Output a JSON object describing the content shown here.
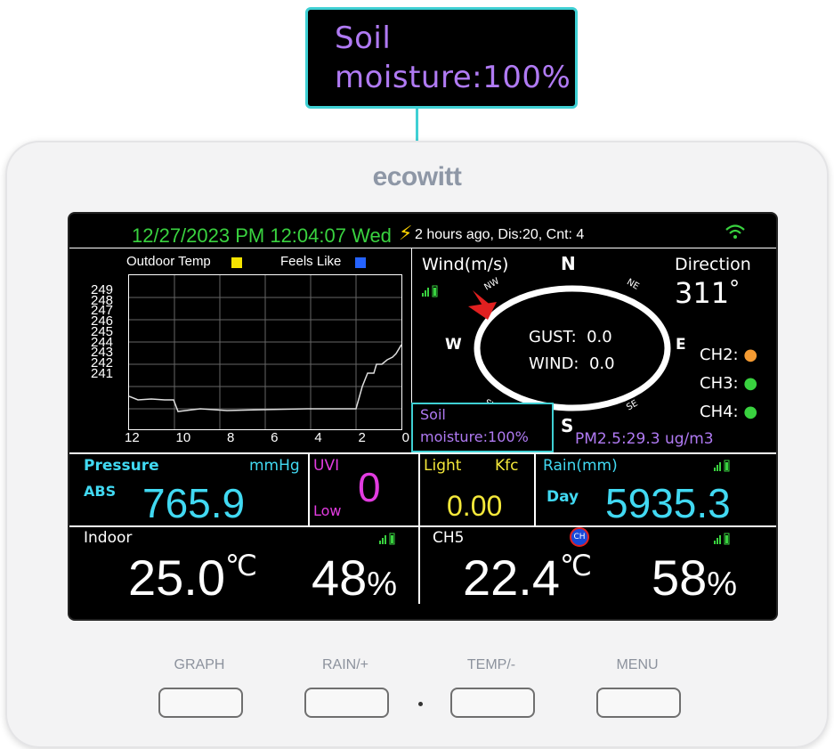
{
  "callout": {
    "line1": "Soil",
    "line2": "moisture:100%"
  },
  "brand": "ecowitt",
  "status_bar": {
    "datetime": "12/27/2023 PM 12:04:07 Wed",
    "lightning": "2 hours ago, Dis:20, Cnt: 4"
  },
  "graph": {
    "legend_outdoor": "Outdoor Temp",
    "legend_feels": "Feels Like",
    "outdoor_color": "#f5e400",
    "feels_color": "#2563ff",
    "y_ticks": [
      "249",
      "248",
      "247",
      "246",
      "245",
      "244",
      "243",
      "242",
      "241"
    ],
    "x_ticks": [
      "12",
      "10",
      "8",
      "6",
      "4",
      "2",
      "0"
    ]
  },
  "wind": {
    "title": "Wind(m/s)",
    "direction_label": "Direction",
    "direction_value": "311",
    "degree": "°",
    "compass_n": "N",
    "compass_s": "S",
    "compass_e": "E",
    "compass_w": "W",
    "compass_nw": "NW",
    "compass_ne": "NE",
    "compass_sw": "SW",
    "compass_se": "SE",
    "gust": "GUST:  0.0",
    "wind": "WIND:  0.0",
    "ch2": "CH2:",
    "ch3": "CH3:",
    "ch4": "CH4:",
    "soil_line1": "Soil",
    "soil_line2": "moisture:100%",
    "pm25": "PM2.5:29.3 ug/m3"
  },
  "pressure": {
    "title": "Pressure",
    "unit": "mmHg",
    "abs": "ABS",
    "value": "765.9"
  },
  "uvi": {
    "title": "UVI",
    "value": "0",
    "level": "Low"
  },
  "light": {
    "title": "Light",
    "unit": "Kfc",
    "value": "0.00"
  },
  "rain": {
    "title": "Rain(mm)",
    "period": "Day",
    "value": "5935.3"
  },
  "indoor": {
    "title": "Indoor",
    "temp": "25.0",
    "temp_unit": "℃",
    "humidity": "48",
    "hum_unit": "%"
  },
  "ch5": {
    "title": "CH5",
    "badge": "CH",
    "temp": "22.4",
    "temp_unit": "℃",
    "humidity": "58",
    "hum_unit": "%"
  },
  "buttons": {
    "graph": "GRAPH",
    "rain": "RAIN/+",
    "temp": "TEMP/-",
    "menu": "MENU"
  }
}
